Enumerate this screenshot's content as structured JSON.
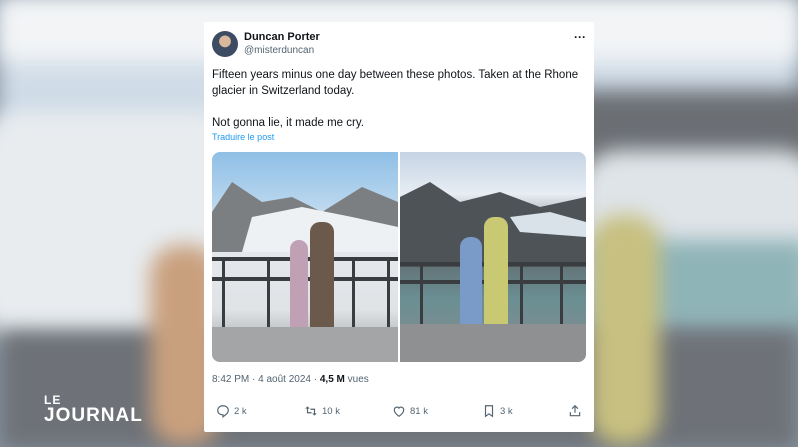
{
  "overlay": {
    "logo_line1": "LE",
    "logo_line2": "JOURNAL"
  },
  "post": {
    "author_name": "Duncan Porter",
    "author_handle": "@misterduncan",
    "text_line1": "Fifteen years minus one day between these photos. Taken at the Rhone glacier in Switzerland today.",
    "text_line2": "Not gonna lie, it made me cry.",
    "translate_label": "Traduire le post",
    "time": "8:42 PM · 4 août 2024 ·",
    "views_count": "4,5 M",
    "views_label": "vues",
    "actions": {
      "replies": "2 k",
      "reposts": "10 k",
      "likes": "81 k",
      "bookmarks": "3 k"
    }
  },
  "icons": [
    "more-icon",
    "reply-icon",
    "repost-icon",
    "like-icon",
    "bookmark-icon",
    "share-icon"
  ],
  "colors": {
    "link": "#1d9bf0",
    "text": "#0f1419",
    "muted": "#536471"
  }
}
